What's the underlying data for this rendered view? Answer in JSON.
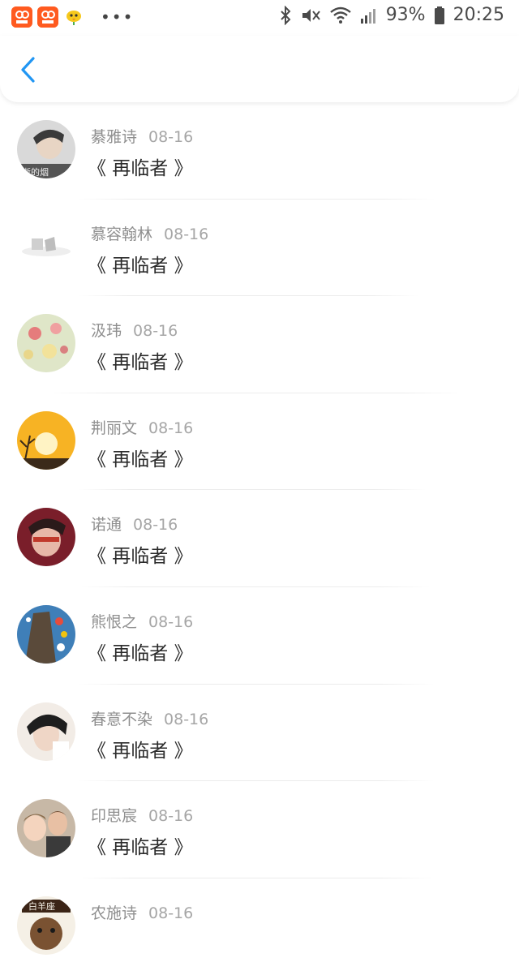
{
  "status_bar": {
    "battery": "93%",
    "time": "20:25",
    "left_icons": [
      "app-badge-icon",
      "app-badge-icon",
      "bird-app-icon",
      "more-dots-icon"
    ],
    "right_icons": [
      "bluetooth-icon",
      "mute-vibrate-icon",
      "wifi-icon",
      "signal-icon",
      "battery-icon"
    ]
  },
  "header": {
    "back_icon": "chevron-left-icon",
    "accent": "#2196f3"
  },
  "items": [
    {
      "name": "綦雅诗",
      "date": "08-16",
      "title": "《 再临者 》"
    },
    {
      "name": "慕容翰林",
      "date": "08-16",
      "title": "《 再临者 》"
    },
    {
      "name": "汲玮",
      "date": "08-16",
      "title": "《 再临者 》"
    },
    {
      "name": "荆丽文",
      "date": "08-16",
      "title": "《 再临者 》"
    },
    {
      "name": "诺通",
      "date": "08-16",
      "title": "《 再临者 》"
    },
    {
      "name": "熊恨之",
      "date": "08-16",
      "title": "《 再临者 》"
    },
    {
      "name": "春意不染",
      "date": "08-16",
      "title": "《 再临者 》"
    },
    {
      "name": "印思宸",
      "date": "08-16",
      "title": "《 再临者 》"
    },
    {
      "name": "农施诗",
      "date": "08-16",
      "title": ""
    }
  ]
}
